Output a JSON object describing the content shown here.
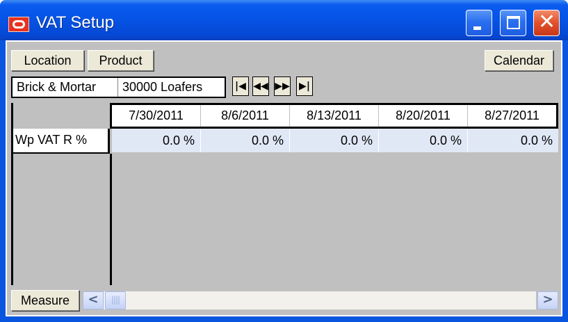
{
  "window": {
    "title": "VAT Setup",
    "icons": {
      "app": "oracle-app-icon",
      "minimize": "minimize-icon",
      "maximize": "maximize-icon",
      "close": "close-icon"
    },
    "close_glyph": "✕"
  },
  "toolbar": {
    "location_label": "Location",
    "product_label": "Product",
    "calendar_label": "Calendar"
  },
  "selector": {
    "location": "Brick & Mortar",
    "product": "30000 Loafers",
    "nav": {
      "first": "|◀",
      "prev": "◀◀",
      "next": "▶▶",
      "last": "▶|"
    }
  },
  "grid": {
    "columns": [
      "7/30/2011",
      "8/6/2011",
      "8/13/2011",
      "8/20/2011",
      "8/27/2011"
    ],
    "rows": [
      {
        "label": "Wp VAT R %",
        "values": [
          "0.0 %",
          "0.0 %",
          "0.0 %",
          "0.0 %",
          "0.0 %"
        ]
      }
    ]
  },
  "bottom": {
    "measure_label": "Measure",
    "scroll_left": "<",
    "scroll_thumb": "||||",
    "scroll_right": ">"
  },
  "colors": {
    "titlebar": "#0653e4",
    "client_bg": "#c0c0c0",
    "row_bg": "#e0e8f6",
    "close_button": "#e2502a"
  }
}
